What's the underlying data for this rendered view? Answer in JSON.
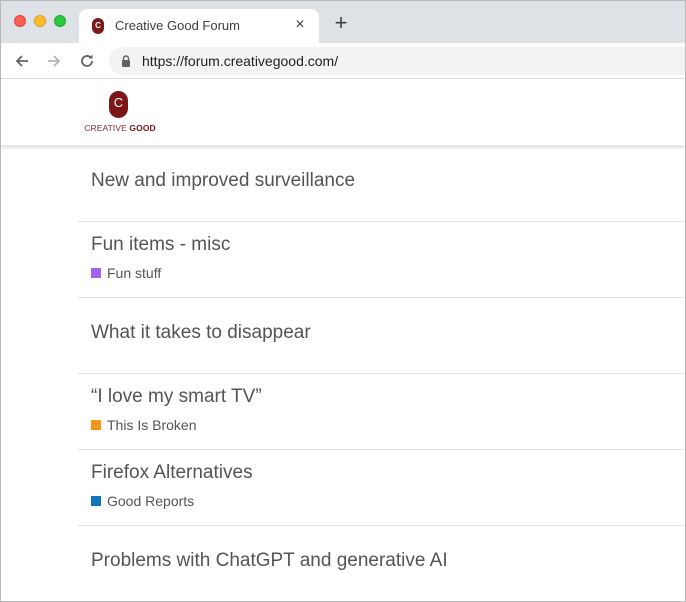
{
  "browser": {
    "tab": {
      "title": "Creative Good Forum",
      "favicon": "C"
    },
    "url": "https://forum.creativegood.com/",
    "icons": {
      "close": "×",
      "new_tab": "+"
    }
  },
  "site": {
    "logo": {
      "mark": "C",
      "text_light": "CREATIVE",
      "text_bold": "GOOD",
      "color": "#7b1717"
    }
  },
  "topics": [
    {
      "title": "New and improved surveillance",
      "category": null,
      "color": null
    },
    {
      "title": "Fun items - misc",
      "category": "Fun stuff",
      "color": "#a461ef"
    },
    {
      "title": "What it takes to disappear",
      "category": null,
      "color": null
    },
    {
      "title": "“I love my smart TV”",
      "category": "This Is Broken",
      "color": "#f7941d"
    },
    {
      "title": "Firefox Alternatives",
      "category": "Good Reports",
      "color": "#0e76bd"
    },
    {
      "title": "Problems with ChatGPT and generative AI",
      "category": null,
      "color": null
    }
  ]
}
